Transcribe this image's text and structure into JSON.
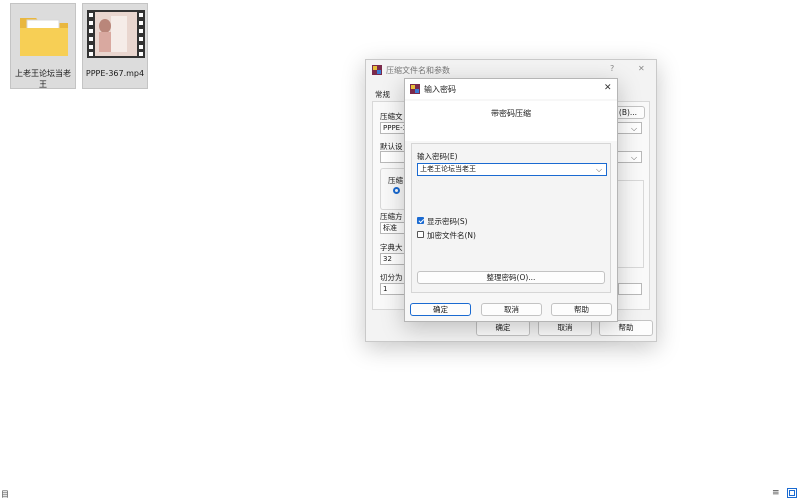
{
  "desktop": {
    "items": [
      {
        "label": "上老王论坛当老王",
        "icon": "folder-icon"
      },
      {
        "label": "PPPE-367.mp4",
        "icon": "video-file-icon"
      }
    ]
  },
  "archive_dialog": {
    "title": "压缩文件名和参数",
    "help_glyph": "?",
    "close_glyph": "✕",
    "tab_general": "常规",
    "label_archive_name": "压缩文",
    "archive_name_value": "PPPE-3",
    "label_default": "默认设",
    "label_format": "压缩",
    "label_method": "压缩方",
    "method_value": "标准",
    "label_dict": "字典大",
    "dict_value": "32",
    "label_split": "切分为",
    "split_value": "1",
    "browse_label": "(B)...",
    "ok_label": "确定",
    "cancel_label": "取消",
    "help_label": "帮助"
  },
  "password_dialog": {
    "title": "输入密码",
    "close_glyph": "✕",
    "heading": "带密码压缩",
    "label_password": "输入密码(E)",
    "password_value": "上老王论坛当老王",
    "show_password_label": "显示密码(S)",
    "show_password_checked": true,
    "encrypt_names_label": "加密文件名(N)",
    "encrypt_names_checked": false,
    "organize_label": "整理密码(O)...",
    "ok_label": "确定",
    "cancel_label": "取消",
    "help_label": "帮助"
  },
  "taskbar": {
    "left_glyph": "目",
    "list_view_glyph": "≡"
  }
}
